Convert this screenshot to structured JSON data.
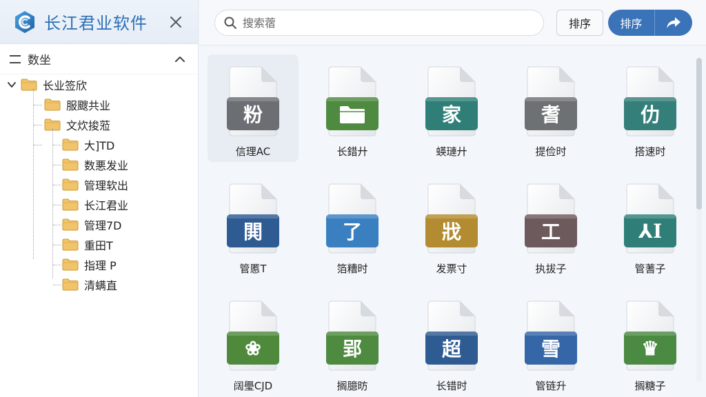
{
  "app": {
    "title": "长江君业软件"
  },
  "sidebar": {
    "section_title": "数坐",
    "tree": [
      {
        "label": "长业签欣",
        "level": 0,
        "expanded": true
      },
      {
        "label": "服颼共业",
        "level": 1
      },
      {
        "label": "文炊捘蒞",
        "level": 1
      },
      {
        "label": "大]TD",
        "level": 2
      },
      {
        "label": "数悪发业",
        "level": 2
      },
      {
        "label": "管理软出",
        "level": 2
      },
      {
        "label": "长江君业",
        "level": 2
      },
      {
        "label": "管理7D",
        "level": 2
      },
      {
        "label": "重田T",
        "level": 2
      },
      {
        "label": "指理 P",
        "level": 2
      },
      {
        "label": "清螨直",
        "level": 2
      }
    ]
  },
  "toolbar": {
    "search_placeholder": "搜索蓿",
    "sort_label": "排序",
    "sort_primary_label": "排序"
  },
  "files": [
    {
      "label": "信理AC",
      "glyph": "粉",
      "color": "#6b6e72",
      "selected": true
    },
    {
      "label": "长錯廾",
      "glyph": "",
      "color": "#4e8a3f",
      "icon": "folder"
    },
    {
      "label": "蝧璉廾",
      "glyph": "家",
      "color": "#2f7f78"
    },
    {
      "label": "提俭时",
      "glyph": "耆",
      "color": "#6e7173"
    },
    {
      "label": "搭速时",
      "glyph": "仂",
      "color": "#357f7a"
    },
    {
      "label": "管慝T",
      "glyph": "閧",
      "color": "#2f5b93"
    },
    {
      "label": "箔糟时",
      "glyph": "了",
      "color": "#3a7fc0",
      "icon": "megaphone"
    },
    {
      "label": "发票寸",
      "glyph": "戕",
      "color": "#b38b30"
    },
    {
      "label": "执拔子",
      "glyph": "工",
      "color": "#6d5a5c"
    },
    {
      "label": "管蓍子",
      "glyph": "⅄I",
      "color": "#2f7f78"
    },
    {
      "label": "阔璺CJD",
      "glyph": "❀",
      "color": "#4f8a3c"
    },
    {
      "label": "搁臆昉",
      "glyph": "郢",
      "color": "#4e8a3f"
    },
    {
      "label": "长错时",
      "glyph": "超",
      "color": "#2f5b93"
    },
    {
      "label": "管链升",
      "glyph": "雪",
      "color": "#3566a8"
    },
    {
      "label": "搁糖子",
      "glyph": "♛",
      "color": "#4a8a42"
    }
  ],
  "colors": {
    "accent": "#3a73b8",
    "brand_text": "#2b6fb6",
    "folder": "#f2c46a"
  }
}
